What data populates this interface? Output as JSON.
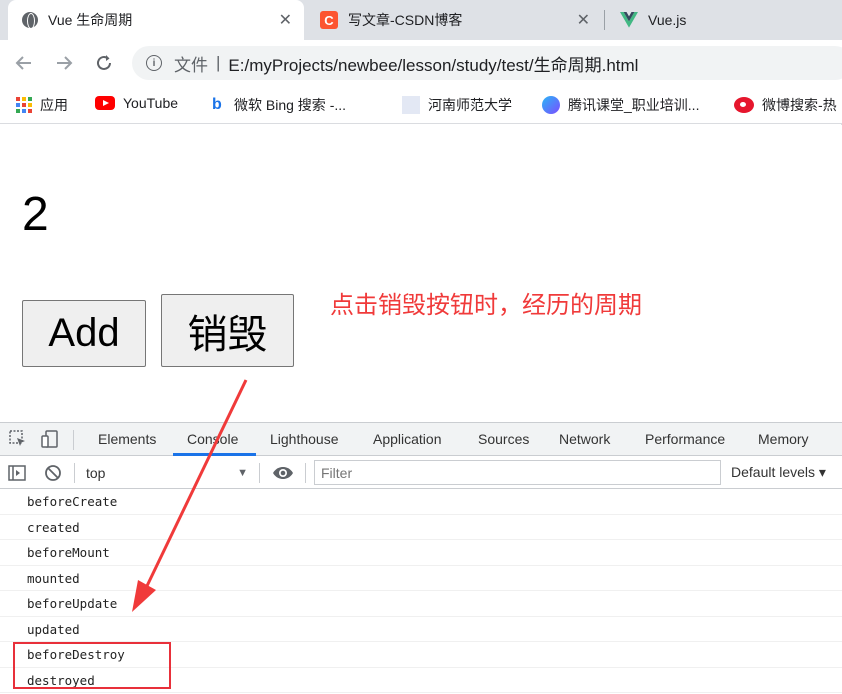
{
  "tabs": [
    {
      "title": "Vue 生命周期",
      "active": true
    },
    {
      "title": "写文章-CSDN博客",
      "icon_letter": "C"
    },
    {
      "title": "Vue.js"
    }
  ],
  "tab_close_glyph": "✕",
  "address": {
    "label": "文件",
    "separator": "|",
    "url": "E:/myProjects/newbee/lesson/study/test/生命周期.html"
  },
  "bookmarks": [
    {
      "label": "应用"
    },
    {
      "label": "YouTube"
    },
    {
      "label": "微软 Bing 搜索 -..."
    },
    {
      "label": "河南师范大学"
    },
    {
      "label": "腾讯课堂_职业培训..."
    },
    {
      "label": "微博搜索-热"
    }
  ],
  "page": {
    "counter": "2",
    "add_label": "Add",
    "destroy_label": "销毁",
    "annotation": "点击销毁按钮时，经历的周期"
  },
  "devtools": {
    "tabs": [
      "Elements",
      "Console",
      "Lighthouse",
      "Application",
      "Sources",
      "Network",
      "Performance",
      "Memory"
    ],
    "active_tab": "Console",
    "context": "top",
    "filter_placeholder": "Filter",
    "levels": "Default levels ▾",
    "logs": [
      "beforeCreate",
      "created",
      "beforeMount",
      "mounted",
      "beforeUpdate",
      "updated",
      "beforeDestroy",
      "destroyed"
    ]
  },
  "colors": {
    "annotation": "#f03a3a",
    "highlight": "#e8303a",
    "active_tab": "#1a73e8"
  }
}
